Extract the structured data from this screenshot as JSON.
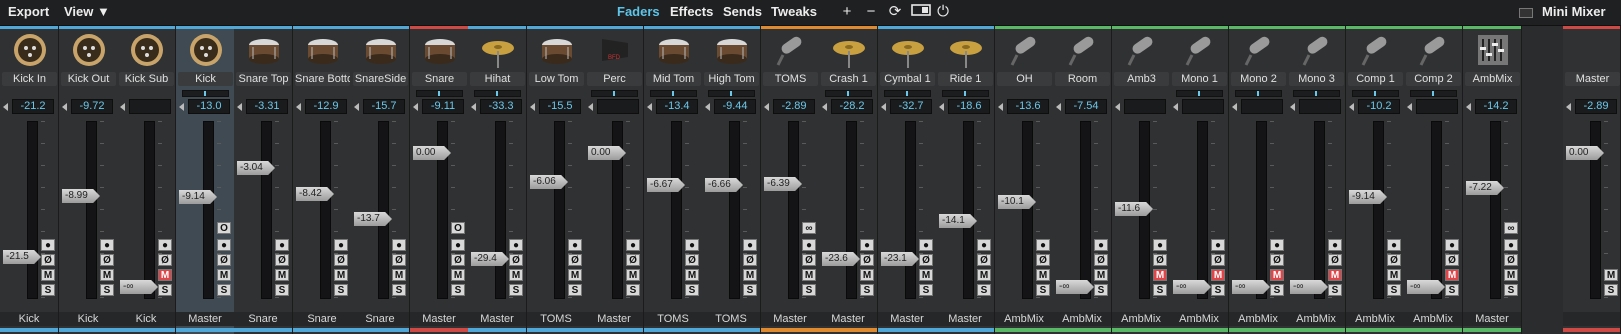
{
  "topbar": {
    "export_label": "Export",
    "view_label": "View ▼",
    "tabs": [
      {
        "label": "Faders",
        "active": true
      },
      {
        "label": "Effects",
        "active": false
      },
      {
        "label": "Sends",
        "active": false
      },
      {
        "label": "Tweaks",
        "active": false
      }
    ],
    "icons": [
      "add-icon",
      "remove-icon",
      "refresh-icon",
      "layout-toggle-icon",
      "power-icon"
    ],
    "mini_mixer_label": "Mini Mixer"
  },
  "colors": {
    "accent": "#5ec4e8",
    "mute_red": "#e0454a",
    "blue_group": "#4fa8d8",
    "orange_group": "#e08a30",
    "green_group": "#59b865",
    "red_group": "#d04a45"
  },
  "channels": [
    {
      "name": "Kick In",
      "volume": "-21.2",
      "fader": "-21.5",
      "output": "Kick",
      "icon": "kick-drum-icon",
      "color": "#4fa8d8",
      "mute": false,
      "pan": false
    },
    {
      "name": "Kick Out",
      "volume": "-9.72",
      "fader": "-8.99",
      "output": "Kick",
      "icon": "kick-drum-icon",
      "color": "#4fa8d8",
      "mute": false,
      "pan": false
    },
    {
      "name": "Kick Sub",
      "volume": "",
      "fader": "-∞",
      "output": "Kick",
      "icon": "kick-drum-icon",
      "color": "#4fa8d8",
      "mute": true,
      "pan": false
    },
    {
      "name": "Kick",
      "volume": "-13.0",
      "fader": "-9.14",
      "output": "Master",
      "icon": "kick-drum-icon",
      "color": "#4fa8d8",
      "mute": false,
      "pan": true,
      "selected": true,
      "top_o": true
    },
    {
      "name": "Snare Top",
      "volume": "-3.31",
      "fader": "-3.04",
      "output": "Snare",
      "icon": "snare-icon",
      "color": "#4fa8d8",
      "mute": false,
      "pan": false
    },
    {
      "name": "Snare Bottom",
      "volume": "-12.9",
      "fader": "-8.42",
      "output": "Snare",
      "icon": "snare-icon",
      "color": "#4fa8d8",
      "mute": false,
      "pan": false
    },
    {
      "name": "SnareSide",
      "volume": "-15.7",
      "fader": "-13.7",
      "output": "Snare",
      "icon": "snare-icon",
      "color": "#4fa8d8",
      "mute": false,
      "pan": false
    },
    {
      "name": "Snare",
      "volume": "-9.11",
      "fader": "0.00",
      "output": "Master",
      "icon": "snare-icon",
      "color": "#d04a45",
      "mute": false,
      "pan": true,
      "top_o": true
    },
    {
      "name": "Hihat",
      "volume": "-33.3",
      "fader": "-29.4",
      "output": "Master",
      "icon": "hihat-icon",
      "color": "#4fa8d8",
      "mute": false,
      "pan": true
    },
    {
      "name": "Low Tom",
      "volume": "-15.5",
      "fader": "-6.06",
      "output": "TOMS",
      "icon": "tom-icon",
      "color": "#4fa8d8",
      "mute": false,
      "pan": false
    },
    {
      "name": "Perc",
      "volume": "",
      "fader": "0.00",
      "output": "Master",
      "icon": "cowbell-icon",
      "color": "#4fa8d8",
      "mute": false,
      "pan": true
    },
    {
      "name": "Mid Tom",
      "volume": "-13.4",
      "fader": "-6.67",
      "output": "TOMS",
      "icon": "tom-icon",
      "color": "#4fa8d8",
      "mute": false,
      "pan": true
    },
    {
      "name": "High Tom",
      "volume": "-9.44",
      "fader": "-6.66",
      "output": "TOMS",
      "icon": "tom-icon",
      "color": "#4fa8d8",
      "mute": false,
      "pan": true
    },
    {
      "name": "TOMS",
      "volume": "-2.89",
      "fader": "-6.39",
      "output": "Master",
      "icon": "mic-icon",
      "color": "#e08a30",
      "mute": false,
      "pan": false,
      "top_link": true
    },
    {
      "name": "Crash 1",
      "volume": "-28.2",
      "fader": "-23.6",
      "output": "Master",
      "icon": "crash-icon",
      "color": "#e08a30",
      "mute": false,
      "pan": true
    },
    {
      "name": "Cymbal 1",
      "volume": "-32.7",
      "fader": "-23.1",
      "output": "Master",
      "icon": "crash-icon",
      "color": "#4fa8d8",
      "mute": false,
      "pan": true
    },
    {
      "name": "Ride 1",
      "volume": "-18.6",
      "fader": "-14.1",
      "output": "Master",
      "icon": "ride-icon",
      "color": "#4fa8d8",
      "mute": false,
      "pan": true
    },
    {
      "name": "OH",
      "volume": "-13.6",
      "fader": "-10.1",
      "output": "AmbMix",
      "icon": "overhead-mic-icon",
      "color": "#59b865",
      "mute": false,
      "pan": false
    },
    {
      "name": "Room",
      "volume": "-7.54",
      "fader": "-∞",
      "output": "AmbMix",
      "icon": "condenser-mic-icon",
      "color": "#59b865",
      "mute": false,
      "pan": false
    },
    {
      "name": "Amb3",
      "volume": "",
      "fader": "-11.6",
      "output": "AmbMix",
      "icon": "mic-icon",
      "color": "#59b865",
      "mute": true,
      "pan": false
    },
    {
      "name": "Mono 1",
      "volume": "",
      "fader": "-∞",
      "output": "AmbMix",
      "icon": "overhead-mic-icon",
      "color": "#59b865",
      "mute": true,
      "pan": true
    },
    {
      "name": "Mono 2",
      "volume": "",
      "fader": "-∞",
      "output": "AmbMix",
      "icon": "condenser-mic-icon",
      "color": "#59b865",
      "mute": true,
      "pan": true
    },
    {
      "name": "Mono 3",
      "volume": "",
      "fader": "-∞",
      "output": "AmbMix",
      "icon": "mic-icon",
      "color": "#59b865",
      "mute": true,
      "pan": true
    },
    {
      "name": "Comp 1",
      "volume": "-10.2",
      "fader": "-9.14",
      "output": "AmbMix",
      "icon": "handheld-mic-icon",
      "color": "#59b865",
      "mute": false,
      "pan": true
    },
    {
      "name": "Comp 2",
      "volume": "",
      "fader": "-∞",
      "output": "AmbMix",
      "icon": "handheld-mic-icon",
      "color": "#59b865",
      "mute": true,
      "pan": true
    },
    {
      "name": "AmbMix",
      "volume": "-14.2",
      "fader": "-7.22",
      "output": "Master",
      "icon": "mixer-icon",
      "color": "#59b865",
      "mute": false,
      "pan": false,
      "top_link": true
    },
    {
      "name": "Master",
      "volume": "-2.89",
      "fader": "0.00",
      "output": "",
      "icon": "master-icon",
      "color": "#d04a45",
      "mute": false,
      "pan": false,
      "master": true
    }
  ],
  "buttons": {
    "record": "●",
    "phase": "Ø",
    "mute": "M",
    "solo": "S",
    "link": "∞",
    "top_o": "O"
  }
}
